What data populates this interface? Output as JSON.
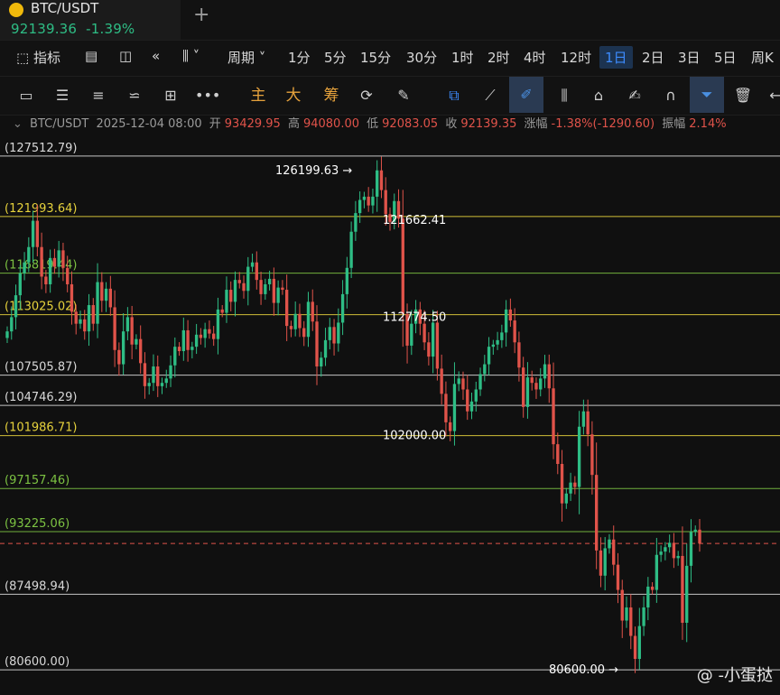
{
  "header": {
    "pair": "BTC/USDT",
    "price": "92139.36",
    "change": "-1.39%"
  },
  "toolbar": {
    "indicators": "指标",
    "period": "周期",
    "intervals": [
      "1分",
      "5分",
      "15分",
      "30分",
      "1时",
      "2时",
      "4时",
      "12时",
      "1日",
      "2日",
      "3日",
      "5日",
      "周K"
    ],
    "selected_interval": "1日"
  },
  "drawing_tools": {
    "main": "主",
    "big": "大",
    "chip": "筹"
  },
  "info_bar": {
    "symbol": "BTC/USDT",
    "datetime": "2025-12-04 08:00",
    "open_label": "开",
    "open": "93429.95",
    "high_label": "高",
    "high": "94080.00",
    "low_label": "低",
    "low": "92083.05",
    "close_label": "收",
    "close": "92139.35",
    "change_label": "涨幅",
    "change": "-1.38%(-1290.60)",
    "amp_label": "振幅",
    "amp": "2.14%"
  },
  "watermark": "@ -小蛋挞",
  "chart_data": {
    "type": "candlestick",
    "ylim": [
      78800,
      128900
    ],
    "current_price": 92139.36,
    "horizontal_levels": [
      {
        "value": 127512.79,
        "label": "(127512.79)",
        "color": "#d8d8d8"
      },
      {
        "value": 121993.64,
        "label": "(121993.64)",
        "color": "#e6d23c"
      },
      {
        "value": 116819.44,
        "label": "(116819.44)",
        "color": "#7cc242"
      },
      {
        "value": 113025.02,
        "label": "(113025.02)",
        "color": "#e6d23c"
      },
      {
        "value": 107505.87,
        "label": "(107505.87)",
        "color": "#d8d8d8"
      },
      {
        "value": 104746.29,
        "label": "(104746.29)",
        "color": "#d8d8d8"
      },
      {
        "value": 101986.71,
        "label": "(101986.71)",
        "color": "#e6d23c"
      },
      {
        "value": 97157.46,
        "label": "(97157.46)",
        "color": "#7cc242"
      },
      {
        "value": 93225.06,
        "label": "(93225.06)",
        "color": "#7cc242"
      },
      {
        "value": 87498.94,
        "label": "(87498.94)",
        "color": "#d8d8d8"
      },
      {
        "value": 80600.0,
        "label": "(80600.00)",
        "color": "#d8d8d8"
      }
    ],
    "annotations": [
      {
        "text": "126199.63 →",
        "value": 126199.63
      },
      {
        "text": "121662.41",
        "value": 121662.41
      },
      {
        "text": "112774.50",
        "value": 112774.5
      },
      {
        "text": "102000.00",
        "value": 102000.0
      },
      {
        "text": "80600.00 →",
        "value": 80600.0
      }
    ],
    "closes": [
      111500,
      112800,
      114800,
      116800,
      117800,
      119200,
      121600,
      119200,
      116500,
      115800,
      118200,
      117400,
      118900,
      117300,
      115800,
      113300,
      112200,
      112600,
      111500,
      113900,
      112200,
      116000,
      114300,
      115400,
      113700,
      109800,
      108500,
      111500,
      112800,
      110300,
      110800,
      108600,
      106500,
      106800,
      108300,
      106500,
      106800,
      107200,
      108400,
      110100,
      109700,
      111600,
      109800,
      110100,
      111200,
      110900,
      111700,
      111300,
      110800,
      113500,
      113200,
      115300,
      114200,
      116200,
      115900,
      115200,
      117400,
      117800,
      116200,
      114900,
      115800,
      116300,
      114100,
      115500,
      115300,
      112000,
      111700,
      113100,
      111800,
      111000,
      114200,
      112400,
      108300,
      109100,
      110700,
      111900,
      110400,
      112300,
      114900,
      117300,
      120600,
      122300,
      123500,
      123800,
      123000,
      123800,
      126200,
      124400,
      122200,
      121500,
      123400,
      121800,
      113100,
      110200,
      112200,
      113500,
      112200,
      110500,
      109200,
      112300,
      108100,
      105800,
      103200,
      102400,
      106700,
      107200,
      106200,
      104200,
      105100,
      106200,
      107600,
      108500,
      110100,
      110300,
      110700,
      111400,
      113500,
      112500,
      110500,
      108200,
      104600,
      107300,
      106800,
      106200,
      107200,
      108500,
      106300,
      101200,
      99400,
      95800,
      96700,
      97700,
      97300,
      102800,
      104200,
      102100,
      98400,
      91500,
      89200,
      91700,
      92500,
      90200,
      87900,
      85100,
      86300,
      83700,
      81600,
      84600,
      86300,
      88200,
      87900,
      91100,
      91400,
      91800,
      92200,
      90800,
      91000,
      84900,
      90100,
      93200,
      93400,
      92139
    ]
  }
}
